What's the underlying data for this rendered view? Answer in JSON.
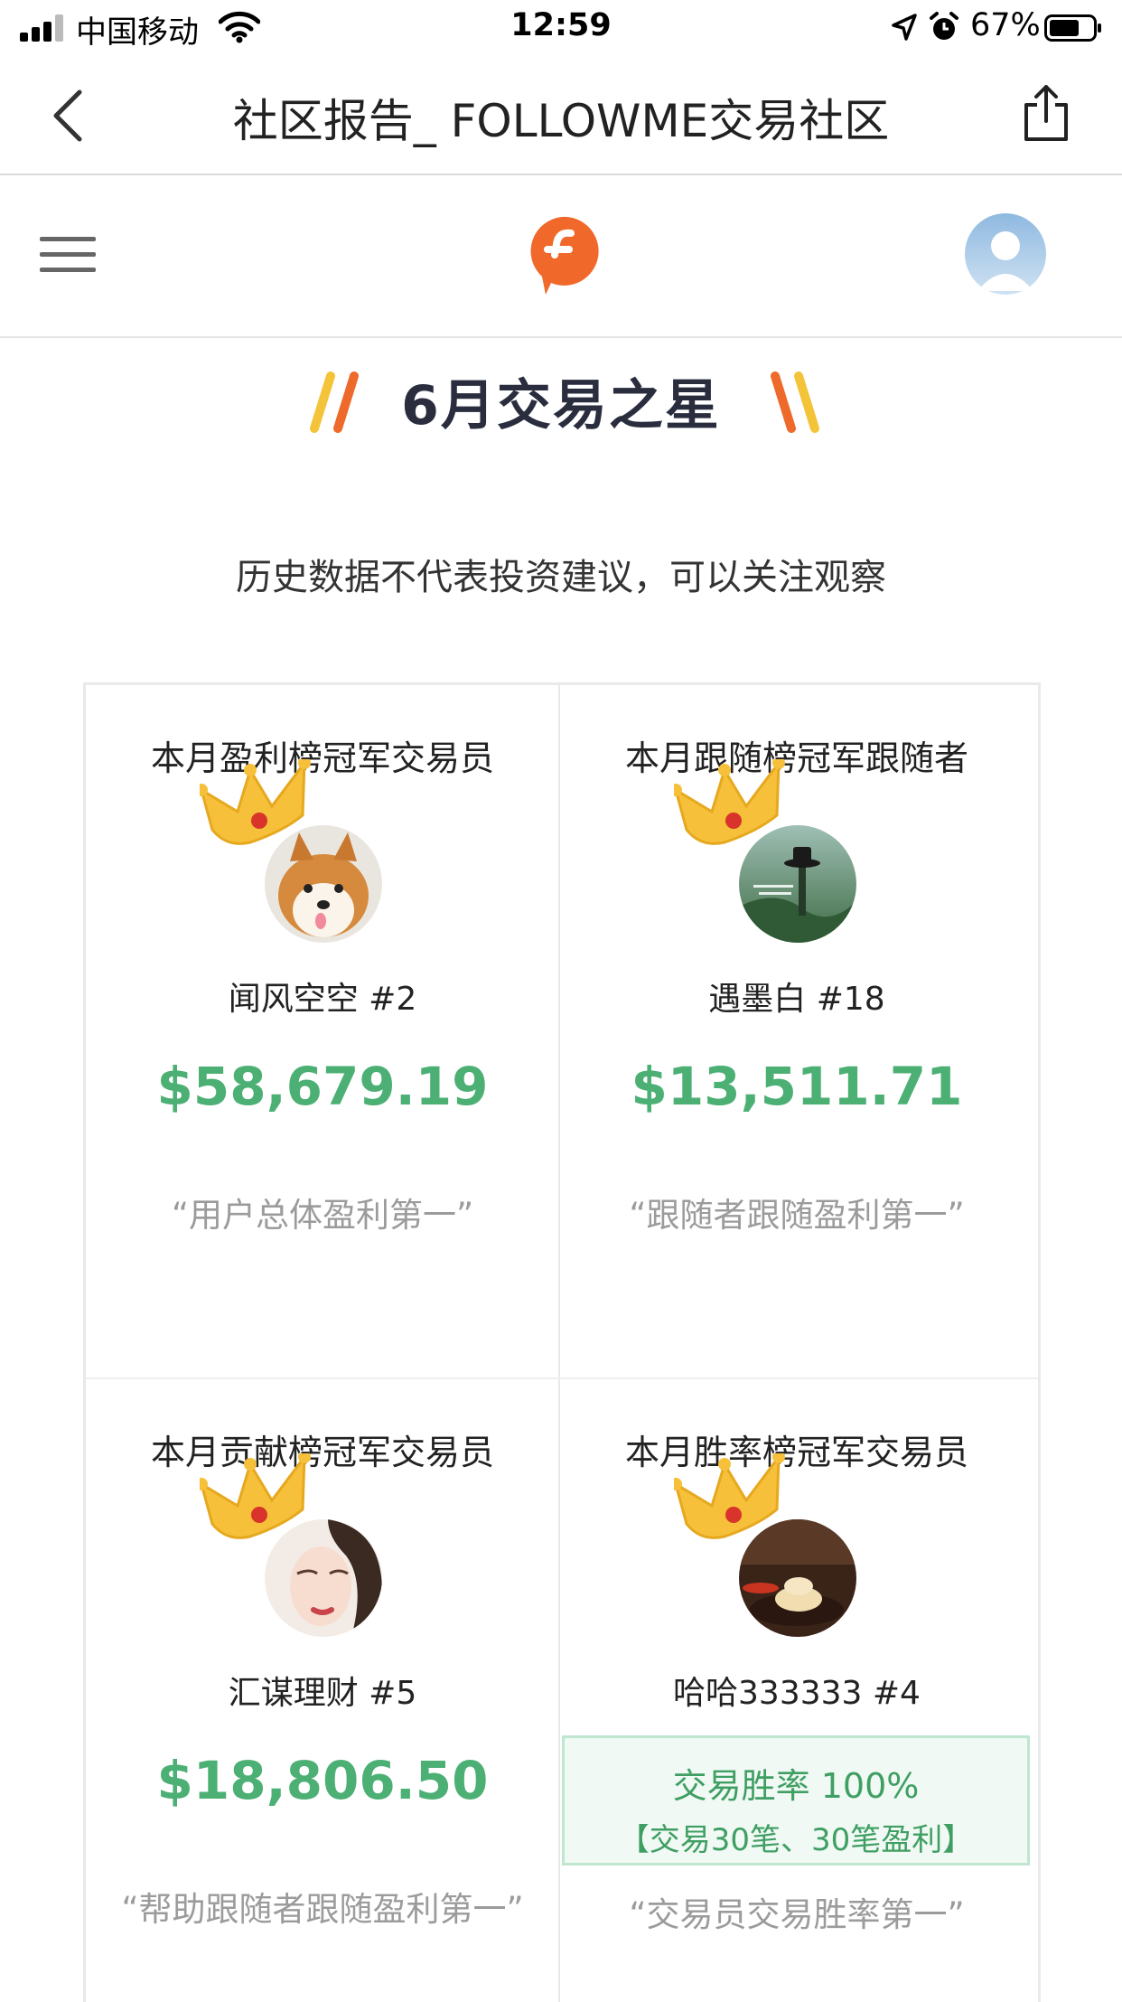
{
  "status_bar": {
    "carrier": "中国移动",
    "time": "12:59",
    "battery_percent": "67%"
  },
  "nav": {
    "title": "社区报告_ FOLLOWME交易社区"
  },
  "banner": {
    "title": "6月交易之星",
    "disclaimer": "历史数据不代表投资建议，可以关注观察"
  },
  "cards": [
    {
      "title": "本月盈利榜冠军交易员",
      "name": "闻风空空 #2",
      "amount": "$58,679.19",
      "quote": "“用户总体盈利第一”"
    },
    {
      "title": "本月跟随榜冠军跟随者",
      "name": "遇墨白 #18",
      "amount": "$13,511.71",
      "quote": "“跟随者跟随盈利第一”"
    },
    {
      "title": "本月贡献榜冠军交易员",
      "name": "汇谋理财 #5",
      "amount": "$18,806.50",
      "quote": "“帮助跟随者跟随盈利第一”"
    },
    {
      "title": "本月胜率榜冠军交易员",
      "name": "哈哈333333 #4",
      "win_rate": "交易胜率 100%",
      "win_detail": "【交易30笔、30笔盈利】",
      "quote": "“交易员交易胜率第一”"
    }
  ],
  "colors": {
    "amount_green": "#4caf74",
    "logo_orange": "#f0682a",
    "quote_gray": "#9b9b9b"
  }
}
